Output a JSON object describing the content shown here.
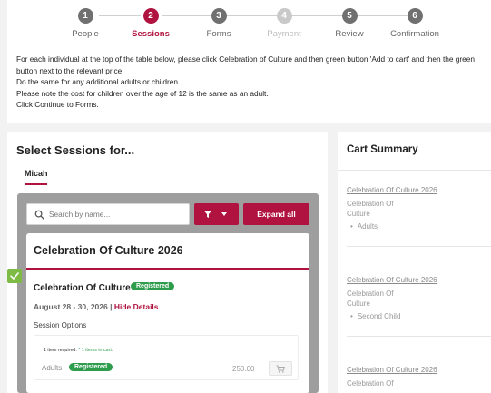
{
  "stepper": {
    "steps": [
      {
        "num": "1",
        "label": "People",
        "state": "done"
      },
      {
        "num": "2",
        "label": "Sessions",
        "state": "active"
      },
      {
        "num": "3",
        "label": "Forms",
        "state": "done"
      },
      {
        "num": "4",
        "label": "Payment",
        "state": "disabled"
      },
      {
        "num": "5",
        "label": "Review",
        "state": "done"
      },
      {
        "num": "6",
        "label": "Confirmation",
        "state": "done"
      }
    ]
  },
  "instructions": {
    "lines": [
      "For each individual at the top of the table below, please click Celebration of Culture and then green button 'Add to cart' and then the green button next to the relevant price.",
      "Do the same for any additional adults or children.",
      "Please note the cost for children over the age of 12 is the same as an adult.",
      "Click Continue to Forms."
    ]
  },
  "sessions_panel": {
    "title": "Select Sessions for...",
    "person_tab": "Micah",
    "search_placeholder": "Search by name...",
    "filter_icon": "filter-icon",
    "expand_all_label": "Expand all",
    "event": {
      "title": "Celebration Of Culture 2026",
      "session_name": "Celebration Of Culture",
      "session_badge": "Registered",
      "dates": "August 28 - 30, 2026 |",
      "hide_details_label": "Hide Details",
      "session_options_label": "Session Options",
      "required_text": "1 item required.",
      "in_cart_text": "* 1 items in cart.",
      "option_label": "Adults",
      "option_badge": "Registered",
      "option_price": "250.00",
      "cart_button_icon": "cart-icon"
    }
  },
  "cart_summary": {
    "title": "Cart Summary",
    "items": [
      {
        "link": "Celebration Of Culture 2026",
        "sub": "Celebration Of Culture",
        "category": "Adults"
      },
      {
        "link": "Celebration Of Culture 2026",
        "sub": "Celebration Of Culture",
        "category": "Second Child"
      },
      {
        "link": "Celebration Of Culture 2026",
        "sub": "Celebration Of",
        "category": ""
      }
    ]
  },
  "colors": {
    "accent": "#b0133f",
    "registered_green": "#2e9c4d",
    "check_green": "#7dbb45"
  }
}
